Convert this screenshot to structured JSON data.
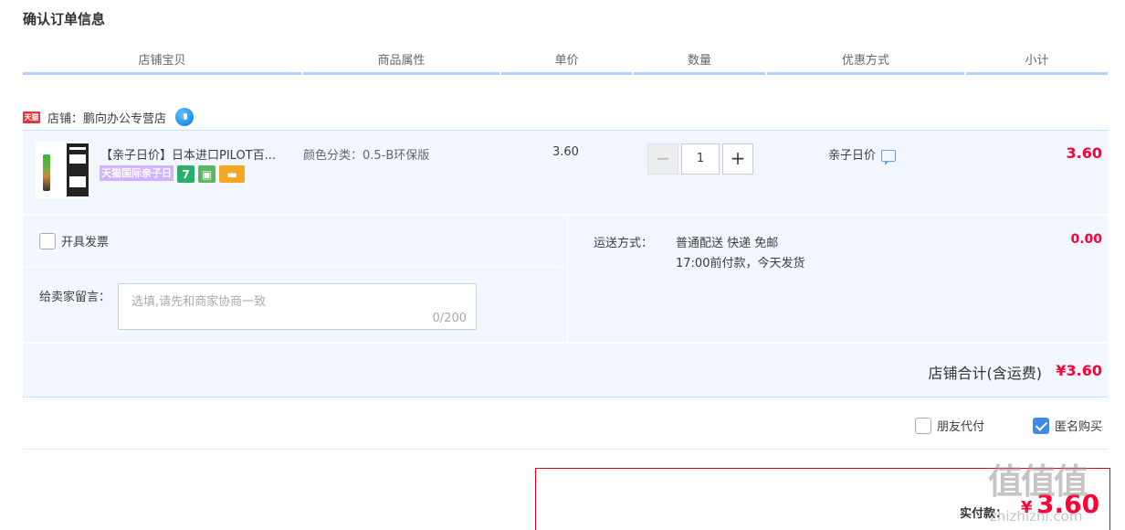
{
  "page": {
    "title": "确认订单信息"
  },
  "header": {
    "columns": [
      "店铺宝贝",
      "商品属性",
      "单价",
      "数量",
      "优惠方式",
      "小计"
    ]
  },
  "shop": {
    "badge": "天猫",
    "label": "店铺：鹏向办公专营店"
  },
  "item": {
    "title": "【亲子日价】日本进口PILOT百...",
    "promo_badge": "天猫国际亲子日",
    "attr": "颜色分类：0.5-B环保版",
    "price": "3.60",
    "quantity": "1",
    "qty_minus": "−",
    "qty_plus": "+",
    "promo_method": "亲子日价",
    "subtotal": "3.60"
  },
  "extras": {
    "invoice_label": "开具发票",
    "message_label": "给卖家留言：",
    "message_placeholder": "选填,请先和商家协商一致",
    "message_count": "0/200",
    "shipping_label": "运送方式：",
    "shipping_line1": "普通配送 快递 免邮",
    "shipping_line2": "17:00前付款，今天发货",
    "shipping_fee": "0.00"
  },
  "shop_total": {
    "label": "店铺合计(含运费)",
    "value": "¥3.60"
  },
  "options": {
    "friend_pay_label": "朋友代付",
    "friend_pay_checked": false,
    "anonymous_label": "匿名购买",
    "anonymous_checked": true
  },
  "payment": {
    "label": "实付款：",
    "symbol": "¥",
    "value": "3.60"
  },
  "watermark": {
    "main": "值值值",
    "sub": "zhizhizhi.com"
  },
  "colors": {
    "accent_red": "#ff0036",
    "header_border": "#b2d1ff",
    "row_bg": "#f2f7ff"
  }
}
